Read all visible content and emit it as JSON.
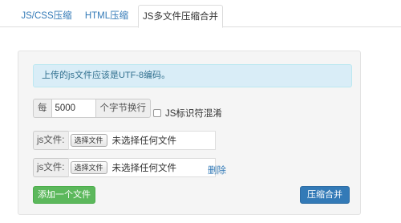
{
  "tabs": [
    {
      "label": "JS/CSS压缩",
      "active": false
    },
    {
      "label": "HTML压缩",
      "active": false
    },
    {
      "label": "JS多文件压缩合并",
      "active": true
    }
  ],
  "alert": {
    "text": "上传的js文件应该是UTF-8编码。"
  },
  "line_break": {
    "prefix": "每",
    "value": "5000",
    "suffix": "个字节换行"
  },
  "obfuscate": {
    "label": "JS标识符混淆",
    "checked": false
  },
  "files": [
    {
      "label": "js文件:",
      "choose_label": "选择文件",
      "status": "未选择任何文件"
    },
    {
      "label": "js文件:",
      "choose_label": "选择文件",
      "status": "未选择任何文件",
      "delete_label": "删除"
    }
  ],
  "buttons": {
    "add_file": "添加一个文件",
    "submit": "压缩合并"
  },
  "colors": {
    "primary": "#337ab7",
    "success": "#5cb85c",
    "info_bg": "#d9edf7",
    "info_text": "#31708f"
  }
}
